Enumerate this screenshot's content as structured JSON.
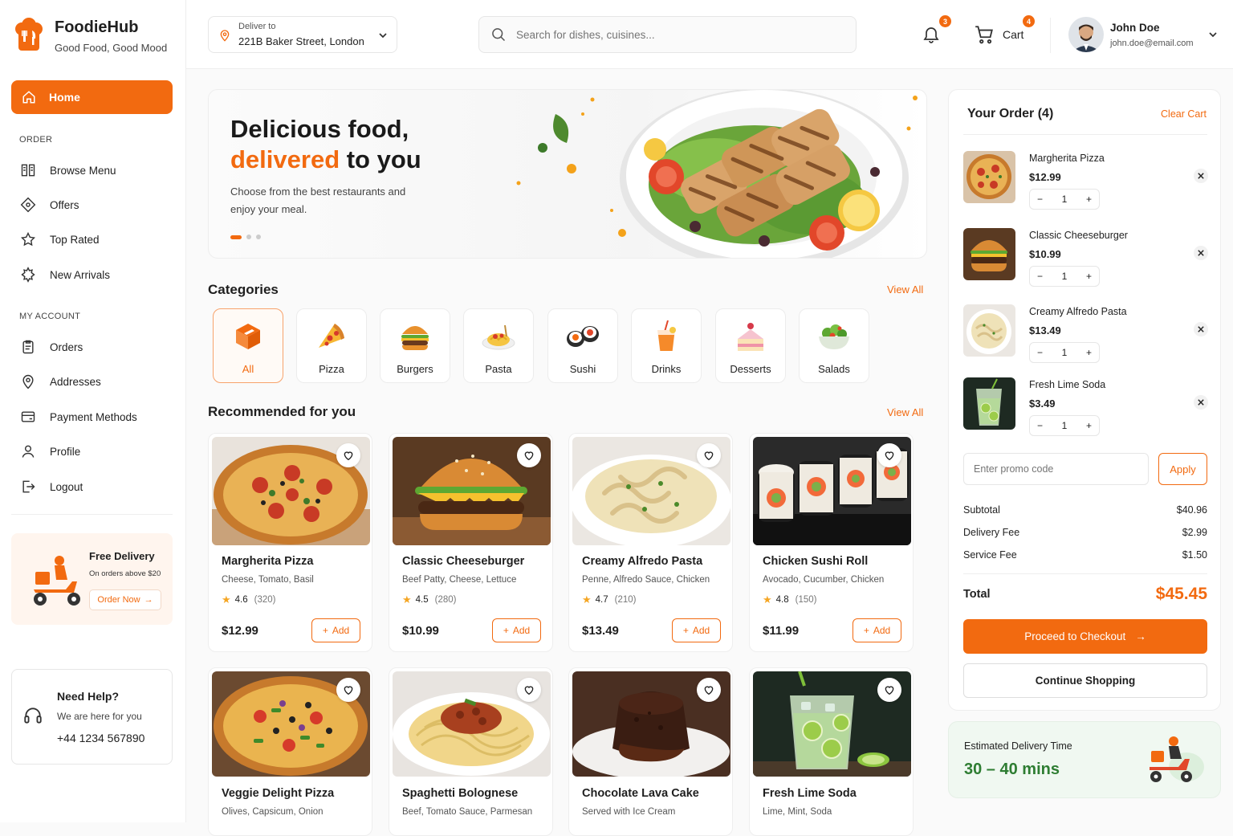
{
  "brand": {
    "name": "FoodieHub",
    "tagline": "Good Food, Good Mood"
  },
  "sidebar": {
    "home": "Home",
    "order_section": "ORDER",
    "order_items": [
      "Browse Menu",
      "Offers",
      "Top Rated",
      "New Arrivals"
    ],
    "account_section": "MY ACCOUNT",
    "account_items": [
      "Orders",
      "Addresses",
      "Payment Methods",
      "Profile",
      "Logout"
    ],
    "promo": {
      "title": "Free Delivery",
      "subtitle": "On orders above $20",
      "button": "Order Now"
    },
    "help": {
      "title": "Need Help?",
      "subtitle": "We are here for you",
      "phone": "+44 1234 567890"
    }
  },
  "header": {
    "deliver_label": "Deliver to",
    "address": "221B Baker Street, London",
    "search_placeholder": "Search for dishes, cuisines...",
    "notifications_count": "3",
    "cart_label": "Cart",
    "cart_count": "4",
    "user_name": "John Doe",
    "user_email": "john.doe@email.com"
  },
  "hero": {
    "line1": "Delicious food,",
    "line2_highlight": "delivered",
    "line2_rest": " to you",
    "desc": "Choose from the best restaurants and enjoy your meal."
  },
  "categories": {
    "title": "Categories",
    "view_all": "View All",
    "items": [
      "All",
      "Pizza",
      "Burgers",
      "Pasta",
      "Sushi",
      "Drinks",
      "Desserts",
      "Salads"
    ]
  },
  "recommended": {
    "title": "Recommended for you",
    "view_all": "View All",
    "add_label": "Add",
    "items": [
      {
        "name": "Margherita Pizza",
        "desc": "Cheese, Tomato, Basil",
        "rating": "4.6",
        "reviews": "(320)",
        "price": "$12.99"
      },
      {
        "name": "Classic Cheeseburger",
        "desc": "Beef Patty, Cheese, Lettuce",
        "rating": "4.5",
        "reviews": "(280)",
        "price": "$10.99"
      },
      {
        "name": "Creamy Alfredo Pasta",
        "desc": "Penne, Alfredo Sauce, Chicken",
        "rating": "4.7",
        "reviews": "(210)",
        "price": "$13.49"
      },
      {
        "name": "Chicken Sushi Roll",
        "desc": "Avocado, Cucumber, Chicken",
        "rating": "4.8",
        "reviews": "(150)",
        "price": "$11.99"
      },
      {
        "name": "Veggie Delight Pizza",
        "desc": "Olives, Capsicum, Onion"
      },
      {
        "name": "Spaghetti Bolognese",
        "desc": "Beef, Tomato Sauce, Parmesan"
      },
      {
        "name": "Chocolate Lava Cake",
        "desc": "Served with Ice Cream"
      },
      {
        "name": "Fresh Lime Soda",
        "desc": "Lime, Mint, Soda"
      }
    ]
  },
  "order": {
    "title": "Your Order (4)",
    "clear": "Clear Cart",
    "items": [
      {
        "name": "Margherita Pizza",
        "price": "$12.99",
        "qty": "1"
      },
      {
        "name": "Classic Cheeseburger",
        "price": "$10.99",
        "qty": "1"
      },
      {
        "name": "Creamy Alfredo Pasta",
        "price": "$13.49",
        "qty": "1"
      },
      {
        "name": "Fresh Lime Soda",
        "price": "$3.49",
        "qty": "1"
      }
    ],
    "promo_placeholder": "Enter promo code",
    "apply": "Apply",
    "subtotal_label": "Subtotal",
    "subtotal": "$40.96",
    "delivery_label": "Delivery Fee",
    "delivery": "$2.99",
    "service_label": "Service Fee",
    "service": "$1.50",
    "total_label": "Total",
    "total": "$45.45",
    "checkout": "Proceed to Checkout",
    "continue": "Continue Shopping"
  },
  "eta": {
    "label": "Estimated Delivery Time",
    "value": "30 – 40 mins"
  },
  "colors": {
    "accent": "#f26a10",
    "green": "#2e7d32"
  }
}
